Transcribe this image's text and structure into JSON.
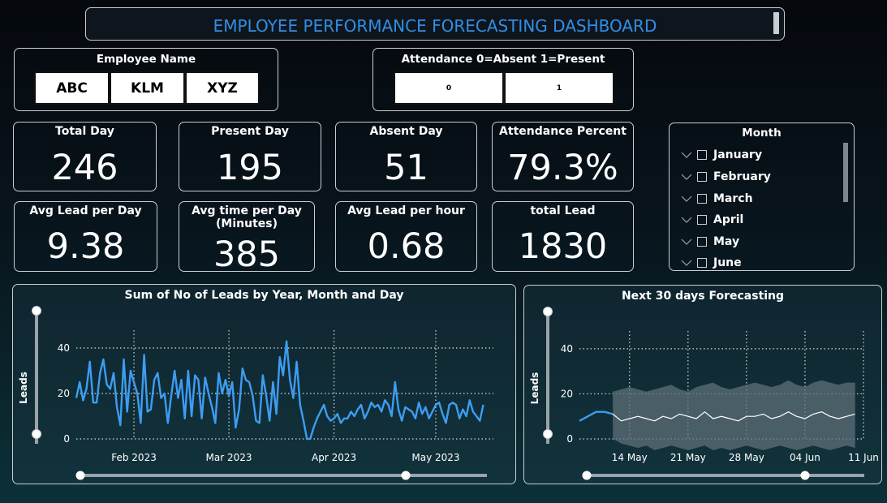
{
  "title": "EMPLOYEE PERFORMANCE FORECASTING DASHBOARD",
  "employee_slicer": {
    "title": "Employee Name",
    "options": [
      "ABC",
      "KLM",
      "XYZ"
    ]
  },
  "attendance_slicer": {
    "title": "Attendance 0=Absent 1=Present",
    "options": [
      "0",
      "1"
    ]
  },
  "cards": {
    "total_day": {
      "label": "Total Day",
      "value": "246"
    },
    "present_day": {
      "label": "Present Day",
      "value": "195"
    },
    "absent_day": {
      "label": "Absent Day",
      "value": "51"
    },
    "attendance_percent": {
      "label": "Attendance Percent",
      "value": "79.3%"
    },
    "avg_lead_per_day": {
      "label": "Avg Lead per Day",
      "value": "9.38"
    },
    "avg_time_per_day": {
      "label": "Avg time per Day\n(Minutes)",
      "value": "385"
    },
    "avg_lead_per_hour": {
      "label": "Avg Lead per hour",
      "value": "0.68"
    },
    "total_lead": {
      "label": "total Lead",
      "value": "1830"
    }
  },
  "month_slicer": {
    "title": "Month",
    "items": [
      "January",
      "February",
      "March",
      "April",
      "May",
      "June"
    ]
  },
  "colors": {
    "accent": "#2f8fe6",
    "series": "#3d9df2",
    "forecast": "#ffffff",
    "band": "#5e6f78"
  },
  "chart_data": [
    {
      "type": "line",
      "title": "Sum of No of Leads by Year, Month and Day",
      "xlabel": "",
      "ylabel": "Leads",
      "x_ticks": [
        "Feb 2023",
        "Mar 2023",
        "Apr 2023",
        "May 2023"
      ],
      "y_ticks": [
        0,
        20,
        40
      ],
      "ylim": [
        0,
        45
      ],
      "x_range": [
        "2023-01-15",
        "2023-05-18"
      ],
      "grid": true,
      "series": [
        {
          "x_start": "2023-01-15",
          "step_days": 1,
          "values": [
            18,
            25,
            17,
            22,
            34,
            16,
            16,
            29,
            35,
            24,
            22,
            29,
            14,
            6,
            35,
            12,
            30,
            25,
            20,
            7,
            37,
            12,
            13,
            26,
            29,
            18,
            20,
            7,
            19,
            30,
            18,
            26,
            9,
            30,
            10,
            28,
            26,
            9,
            27,
            20,
            14,
            7,
            29,
            20,
            26,
            19,
            25,
            5,
            13,
            31,
            26,
            25,
            19,
            8,
            7,
            28,
            19,
            8,
            25,
            11,
            36,
            28,
            43,
            26,
            18,
            34,
            15,
            8,
            0,
            0,
            5,
            9,
            12,
            15,
            10,
            8,
            9,
            11,
            7,
            9,
            9,
            12,
            10,
            13,
            15,
            9,
            12,
            16,
            14,
            15,
            12,
            17,
            15,
            10,
            25,
            13,
            8,
            14,
            13,
            12,
            9,
            16,
            11,
            14,
            9,
            12,
            15,
            16,
            11,
            7,
            15,
            16,
            15,
            9,
            13,
            10,
            17,
            12,
            10,
            8,
            15
          ]
        }
      ]
    },
    {
      "type": "line",
      "title": "Next 30 days Forecasting",
      "xlabel": "",
      "ylabel": "Leads",
      "x_ticks": [
        "14 May",
        "21 May",
        "28 May",
        "04 Jun",
        "11 Jun"
      ],
      "y_ticks": [
        0,
        20,
        40
      ],
      "ylim": [
        0,
        45
      ],
      "x_range": [
        "2023-05-08",
        "2023-06-11"
      ],
      "grid": true,
      "series": [
        {
          "label": "actual",
          "x_start": "2023-05-08",
          "step_days": 1,
          "values": [
            8,
            10,
            12,
            12,
            11
          ]
        },
        {
          "label": "forecast",
          "x_start": "2023-05-12",
          "step_days": 1,
          "values": [
            11,
            8,
            9,
            10,
            9,
            8,
            10,
            9,
            11,
            10,
            9,
            12,
            9,
            10,
            9,
            8,
            10,
            10,
            11,
            9,
            10,
            12,
            10,
            9,
            11,
            12,
            10,
            9,
            10,
            11
          ],
          "upper": [
            21,
            22,
            23,
            22,
            21,
            22,
            23,
            24,
            22,
            21,
            23,
            24,
            25,
            23,
            22,
            23,
            24,
            25,
            24,
            23,
            24,
            26,
            24,
            23,
            25,
            26,
            25,
            24,
            25,
            25
          ],
          "lower": [
            0,
            -2,
            -3,
            -4,
            -3,
            -5,
            -4,
            -3,
            -4,
            -5,
            -4,
            -3,
            -5,
            -4,
            -5,
            -4,
            -3,
            -4,
            -5,
            -4,
            -3,
            -4,
            -5,
            -4,
            -3,
            -4,
            -5,
            -4,
            -3,
            -4
          ]
        }
      ]
    }
  ]
}
